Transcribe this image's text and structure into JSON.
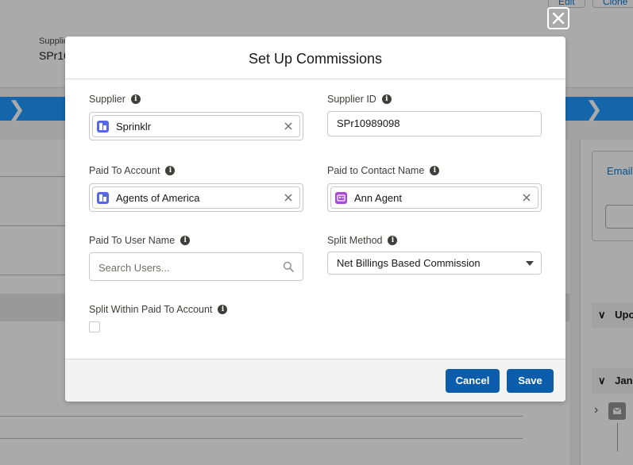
{
  "background": {
    "header_label": "Supplie",
    "header_value": "SPr10",
    "top_buttons": [
      "Edit",
      "Clone"
    ],
    "right_link": "Email",
    "right_sections": [
      "Upc",
      "Jan"
    ]
  },
  "modal": {
    "title": "Set Up Commissions",
    "fields": {
      "supplier": {
        "label": "Supplier",
        "value": "Sprinklr",
        "icon": "account-icon"
      },
      "supplier_id": {
        "label": "Supplier ID",
        "value": "SPr10989098"
      },
      "paid_to_account": {
        "label": "Paid To Account",
        "value": "Agents of America",
        "icon": "account-icon"
      },
      "paid_to_contact": {
        "label": "Paid to Contact Name",
        "value": "Ann Agent",
        "icon": "contact-icon"
      },
      "paid_to_user": {
        "label": "Paid To User Name",
        "placeholder": "Search Users..."
      },
      "split_method": {
        "label": "Split Method",
        "value": "Net Billings Based Commission"
      },
      "split_within": {
        "label": "Split Within Paid To Account",
        "checked": false
      }
    },
    "buttons": {
      "cancel": "Cancel",
      "save": "Save"
    }
  },
  "colors": {
    "brand_button": "#0b5cab",
    "account_icon": "#5867e8",
    "contact_icon": "#a94ad4",
    "path_blue": "#1b96ff"
  }
}
